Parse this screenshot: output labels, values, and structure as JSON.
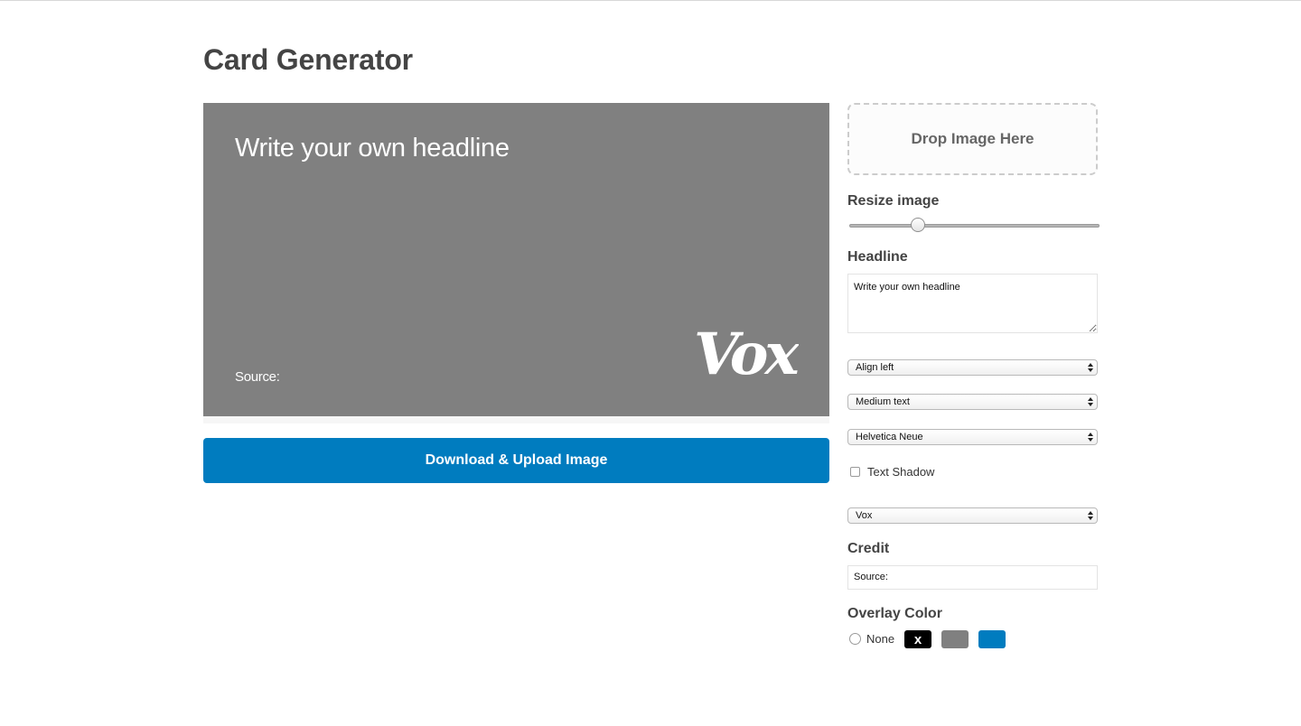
{
  "page": {
    "title": "Card Generator"
  },
  "preview": {
    "headline": "Write your own headline",
    "source": "Source:",
    "logo_text": "Vox",
    "background_color": "#808080"
  },
  "actions": {
    "download_label": "Download & Upload Image",
    "button_color": "#007cbf"
  },
  "panel": {
    "drop_zone_label": "Drop Image Here",
    "resize_label": "Resize image",
    "resize_value": 0.26,
    "headline_label": "Headline",
    "headline_value": "Write your own headline",
    "align_selected": "Align left",
    "size_selected": "Medium text",
    "font_selected": "Helvetica Neue",
    "text_shadow_label": "Text Shadow",
    "text_shadow_checked": false,
    "logo_selected": "Vox",
    "credit_label": "Credit",
    "credit_value": "Source:",
    "overlay_label": "Overlay Color",
    "overlay_none_label": "None",
    "overlay_swatches": [
      {
        "name": "black",
        "color": "#000000",
        "mark": "x"
      },
      {
        "name": "gray",
        "color": "#808080"
      },
      {
        "name": "blue",
        "color": "#007cbf"
      }
    ]
  }
}
